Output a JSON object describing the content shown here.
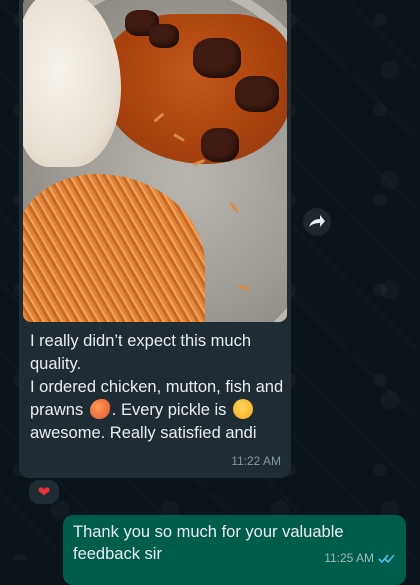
{
  "incoming": {
    "lines": [
      "I really didn’t expect this much quality.",
      "I ordered chicken, mutton, fish and prawns",
      ". Every pickle is",
      "awesome. Really satisfied andi"
    ],
    "time": "11:22 AM",
    "reaction_icon": "heart",
    "image_icon": "food-photo"
  },
  "outgoing": {
    "text": "Thank you so much for your valuable feedback sir",
    "time": "11:25 AM",
    "status_icon": "double-check-read"
  },
  "colors": {
    "background": "#0b141a",
    "incoming_bubble": "#202c33",
    "outgoing_bubble": "#005c4b",
    "read_ticks": "#53bdeb",
    "heart": "#e8333b"
  }
}
